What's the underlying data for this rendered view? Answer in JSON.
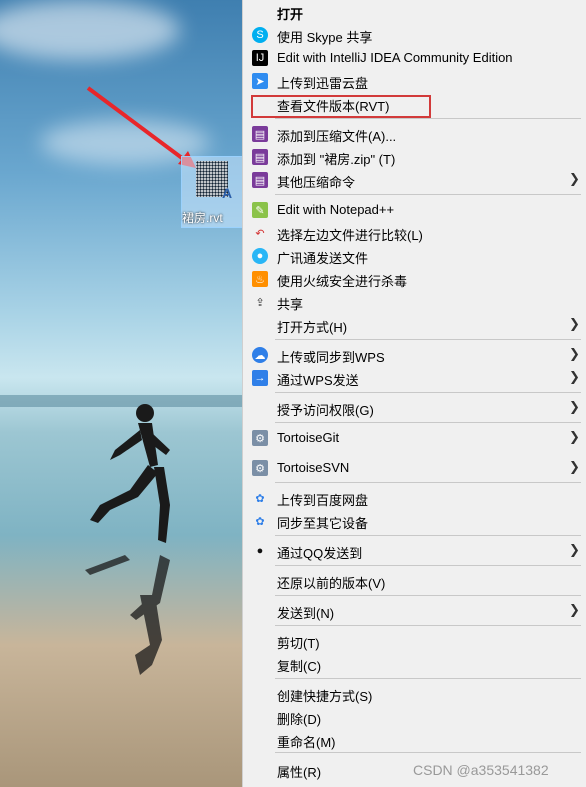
{
  "file": {
    "name": "裙房.rvt"
  },
  "menu": {
    "items": [
      {
        "label": "打开",
        "icon": "",
        "bold": true
      },
      {
        "label": "使用 Skype 共享",
        "icon": "skype-icon"
      },
      {
        "label": "Edit with IntelliJ IDEA Community Edition",
        "icon": "intellij-icon"
      },
      {
        "label": "上传到迅雷云盘",
        "icon": "xunlei-icon"
      },
      {
        "label": "查看文件版本(RVT)",
        "icon": ""
      },
      {
        "label": "添加到压缩文件(A)...",
        "icon": "winrar-icon"
      },
      {
        "label": "添加到 \"裙房.zip\" (T)",
        "icon": "winrar-icon"
      },
      {
        "label": "其他压缩命令",
        "icon": "winrar-icon",
        "submenu": true
      },
      {
        "label": "Edit with Notepad++",
        "icon": "notepad-icon"
      },
      {
        "label": "选择左边文件进行比较(L)",
        "icon": "compare-icon"
      },
      {
        "label": "广讯通发送文件",
        "icon": "guangxun-icon"
      },
      {
        "label": "使用火绒安全进行杀毒",
        "icon": "huorong-icon"
      },
      {
        "label": "共享",
        "icon": "share-icon"
      },
      {
        "label": "打开方式(H)",
        "icon": "",
        "submenu": true
      },
      {
        "label": "上传或同步到WPS",
        "icon": "wps-cloud-icon",
        "submenu": true
      },
      {
        "label": "通过WPS发送",
        "icon": "wps-send-icon",
        "submenu": true
      },
      {
        "label": "授予访问权限(G)",
        "icon": "",
        "submenu": true
      },
      {
        "label": "TortoiseGit",
        "icon": "tortoisegit-icon",
        "submenu": true
      },
      {
        "label": "TortoiseSVN",
        "icon": "tortoisesvn-icon",
        "submenu": true
      },
      {
        "label": "上传到百度网盘",
        "icon": "baidu-icon"
      },
      {
        "label": "同步至其它设备",
        "icon": "baidu-icon"
      },
      {
        "label": "通过QQ发送到",
        "icon": "qq-icon",
        "submenu": true
      },
      {
        "label": "还原以前的版本(V)",
        "icon": ""
      },
      {
        "label": "发送到(N)",
        "icon": "",
        "submenu": true
      },
      {
        "label": "剪切(T)",
        "icon": ""
      },
      {
        "label": "复制(C)",
        "icon": ""
      },
      {
        "label": "创建快捷方式(S)",
        "icon": ""
      },
      {
        "label": "删除(D)",
        "icon": ""
      },
      {
        "label": "重命名(M)",
        "icon": ""
      },
      {
        "label": "属性(R)",
        "icon": ""
      }
    ]
  },
  "watermark": "CSDN @a353541382"
}
